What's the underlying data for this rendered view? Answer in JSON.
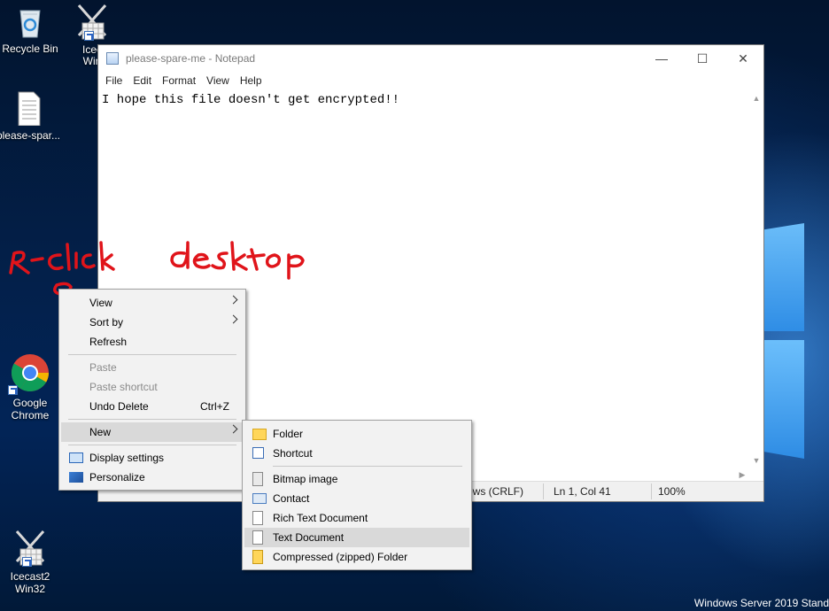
{
  "desktop": {
    "icons": [
      {
        "label": "Recycle Bin"
      },
      {
        "label": "Icec Win"
      },
      {
        "label": "please-spar..."
      },
      {
        "label": "Google Chrome"
      },
      {
        "label": "Icecast2 Win32"
      }
    ],
    "annotation": "R-click desktop",
    "watermark": "Windows Server 2019 Stand"
  },
  "notepad": {
    "title": "please-spare-me - Notepad",
    "menu": [
      "File",
      "Edit",
      "Format",
      "View",
      "Help"
    ],
    "content": "I hope this file doesn't get encrypted!!",
    "status": {
      "encoding": "ows (CRLF)",
      "position": "Ln 1, Col 41",
      "zoom": "100%"
    },
    "buttons": {
      "minimize": "—",
      "maximize": "☐",
      "close": "✕"
    }
  },
  "context_menu": {
    "items": [
      {
        "label": "View"
      },
      {
        "label": "Sort by"
      },
      {
        "label": "Refresh"
      },
      {
        "label": "Paste"
      },
      {
        "label": "Paste shortcut"
      },
      {
        "label": "Undo Delete",
        "shortcut": "Ctrl+Z"
      },
      {
        "label": "New"
      },
      {
        "label": "Display settings"
      },
      {
        "label": "Personalize"
      }
    ]
  },
  "new_submenu": {
    "items": [
      {
        "label": "Folder"
      },
      {
        "label": "Shortcut"
      },
      {
        "label": "Bitmap image"
      },
      {
        "label": "Contact"
      },
      {
        "label": "Rich Text Document"
      },
      {
        "label": "Text Document"
      },
      {
        "label": "Compressed (zipped) Folder"
      }
    ]
  },
  "colors": {
    "annotation": "#e0141a",
    "menu_highlight": "#d9d9d9",
    "desktop": "#03204a"
  }
}
